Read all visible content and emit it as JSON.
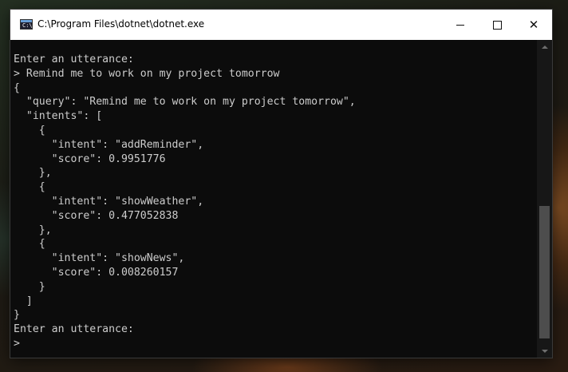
{
  "window": {
    "title": "C:\\Program Files\\dotnet\\dotnet.exe",
    "icon": "console-app-icon",
    "icon_text": "C:\\",
    "controls": {
      "minimize": "minimize",
      "maximize": "maximize",
      "close": "✕"
    }
  },
  "console": {
    "lines": [
      "Enter an utterance:",
      "> Remind me to work on my project tomorrow",
      "{",
      "  \"query\": \"Remind me to work on my project tomorrow\",",
      "  \"intents\": [",
      "    {",
      "      \"intent\": \"addReminder\",",
      "      \"score\": 0.9951776",
      "    },",
      "    {",
      "      \"intent\": \"showWeather\",",
      "      \"score\": 0.477052838",
      "    },",
      "    {",
      "      \"intent\": \"showNews\",",
      "      \"score\": 0.008260157",
      "    }",
      "  ]",
      "}",
      "Enter an utterance:",
      ">"
    ],
    "colors": {
      "background": "#0c0c0c",
      "foreground": "#cccccc"
    }
  },
  "scrollbar": {
    "position_fraction": 1.0
  }
}
